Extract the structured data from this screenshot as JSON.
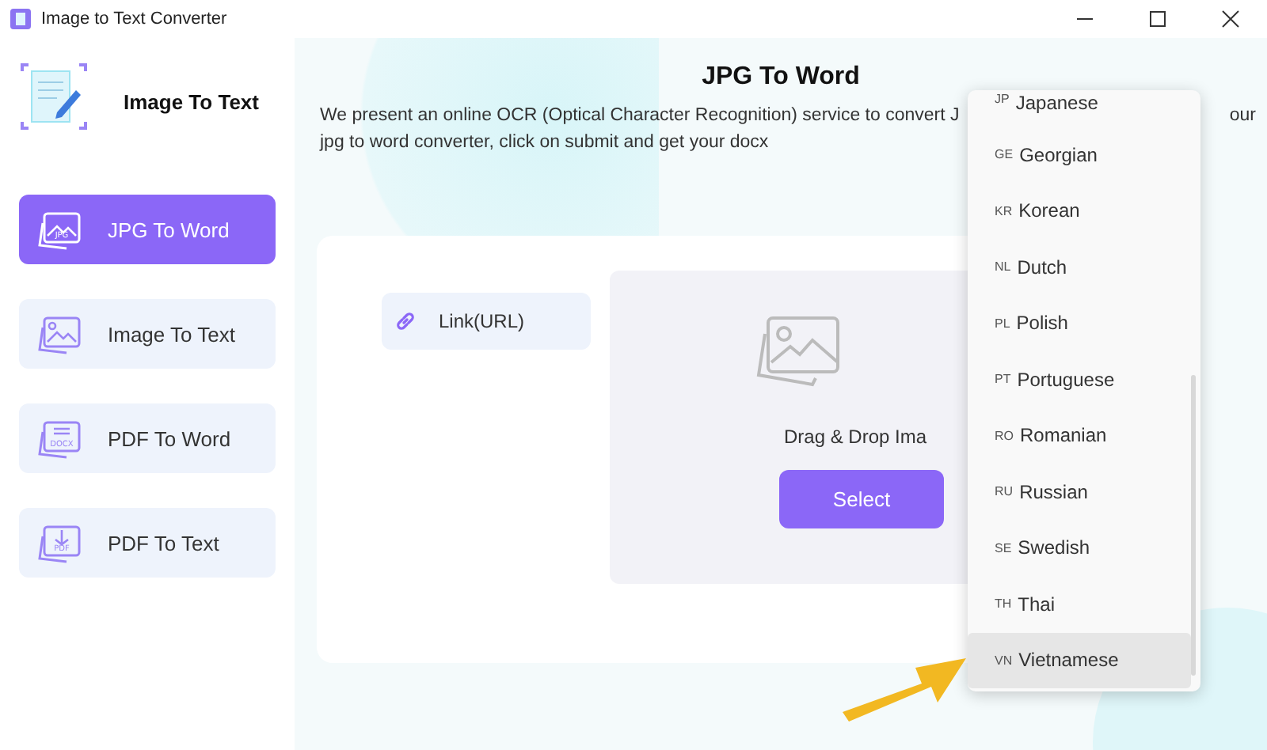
{
  "window": {
    "title": "Image to Text Converter"
  },
  "sidebar": {
    "app_name": "Image To Text",
    "items": [
      {
        "label": "JPG To Word",
        "kind": "jpg",
        "icon_label": "JPG",
        "selected": true
      },
      {
        "label": "Image To Text",
        "kind": "image",
        "selected": false
      },
      {
        "label": "PDF To Word",
        "kind": "docx",
        "icon_label": "DOCX",
        "selected": false
      },
      {
        "label": "PDF To Text",
        "kind": "pdf",
        "icon_label": "PDF",
        "selected": false
      }
    ]
  },
  "main": {
    "title": "JPG To Word",
    "description_lines": [
      {
        "left": "We present an online OCR (Optical Character Recognition) service to convert J",
        "right": "our"
      },
      {
        "left": "jpg to word converter, click on submit and get your docx"
      }
    ],
    "link_button": "Link(URL)",
    "drop_text": "Drag & Drop Ima",
    "select_button": "Select"
  },
  "language_dropdown": {
    "items": [
      {
        "code": "JP",
        "name": "Japanese",
        "selected": false
      },
      {
        "code": "GE",
        "name": "Georgian",
        "selected": false
      },
      {
        "code": "KR",
        "name": "Korean",
        "selected": false
      },
      {
        "code": "NL",
        "name": "Dutch",
        "selected": false
      },
      {
        "code": "PL",
        "name": "Polish",
        "selected": false
      },
      {
        "code": "PT",
        "name": "Portuguese",
        "selected": false
      },
      {
        "code": "RO",
        "name": "Romanian",
        "selected": false
      },
      {
        "code": "RU",
        "name": "Russian",
        "selected": false
      },
      {
        "code": "SE",
        "name": "Swedish",
        "selected": false
      },
      {
        "code": "TH",
        "name": "Thai",
        "selected": false
      },
      {
        "code": "VN",
        "name": "Vietnamese",
        "selected": true
      }
    ]
  }
}
